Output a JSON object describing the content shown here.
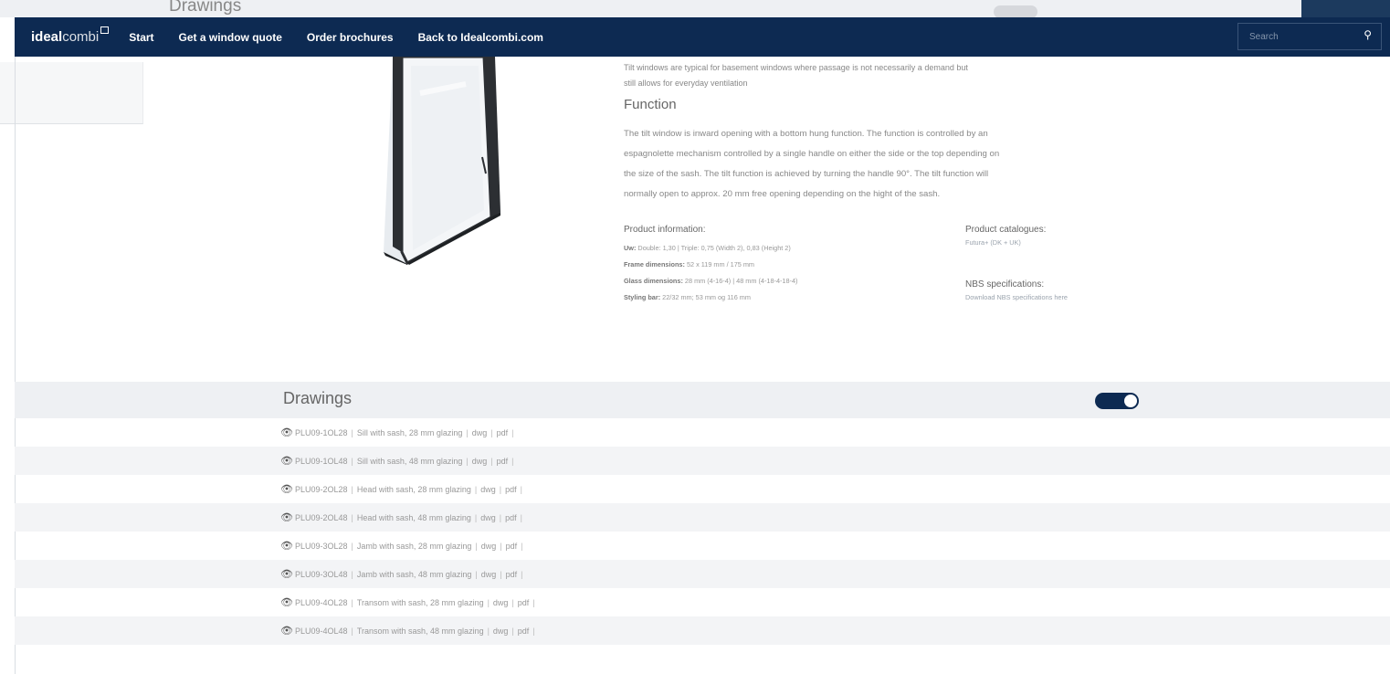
{
  "ghost": {
    "title": "Drawings"
  },
  "navbar": {
    "logo_bold": "ideal",
    "logo_light": "combi",
    "links": [
      "Start",
      "Get a window quote",
      "Order brochures",
      "Back to Idealcombi.com"
    ],
    "search_placeholder": "Search"
  },
  "product": {
    "intro_lines": [
      "Tilt windows are typical for basement windows where passage is not necessarily a demand but",
      "still allows for everyday ventilation"
    ],
    "function_title": "Function",
    "function_lines": [
      "The tilt window is inward opening with a bottom hung function. The function is controlled by an",
      "espagnolette mechanism controlled by a single handle on either the side or the top depending on",
      "the size of the sash. The tilt function is achieved by turning the handle 90°. The tilt function will",
      "normally open to approx. 20 mm free opening depending on the hight of the sash."
    ],
    "info_title": "Product information:",
    "info": [
      {
        "label": "Uw:",
        "value": "Double: 1,30 | Triple: 0,75 (Width 2), 0,83 (Height 2)"
      },
      {
        "label": "Frame dimensions:",
        "value": "52 x 119 mm / 175 mm"
      },
      {
        "label": "Glass dimensions:",
        "value": "28 mm (4-16-4) | 48 mm (4-18-4-18-4)"
      },
      {
        "label": "Styling bar:",
        "value": "22/32 mm; 53 mm og 116 mm"
      }
    ],
    "catalogues_title": "Product catalogues:",
    "catalogues_link": "Futura+ (DK + UK)",
    "nbs_title": "NBS specifications:",
    "nbs_link": "Download NBS specifications here"
  },
  "drawings": {
    "title": "Drawings",
    "toggle_on": true,
    "items": [
      {
        "code": "PLU09-1OL28",
        "desc": "Sill with sash, 28 mm glazing",
        "f1": "dwg",
        "f2": "pdf"
      },
      {
        "code": "PLU09-1OL48",
        "desc": "Sill with sash, 48 mm glazing",
        "f1": "dwg",
        "f2": "pdf"
      },
      {
        "code": "PLU09-2OL28",
        "desc": "Head with sash, 28 mm glazing",
        "f1": "dwg",
        "f2": "pdf"
      },
      {
        "code": "PLU09-2OL48",
        "desc": "Head with sash, 48 mm glazing",
        "f1": "dwg",
        "f2": "pdf"
      },
      {
        "code": "PLU09-3OL28",
        "desc": "Jamb with sash, 28 mm glazing",
        "f1": "dwg",
        "f2": "pdf"
      },
      {
        "code": "PLU09-3OL48",
        "desc": "Jamb with sash, 48 mm glazing",
        "f1": "dwg",
        "f2": "pdf"
      },
      {
        "code": "PLU09-4OL28",
        "desc": "Transom with sash, 28 mm glazing",
        "f1": "dwg",
        "f2": "pdf"
      },
      {
        "code": "PLU09-4OL48",
        "desc": "Transom with sash, 48 mm glazing",
        "f1": "dwg",
        "f2": "pdf"
      }
    ]
  }
}
